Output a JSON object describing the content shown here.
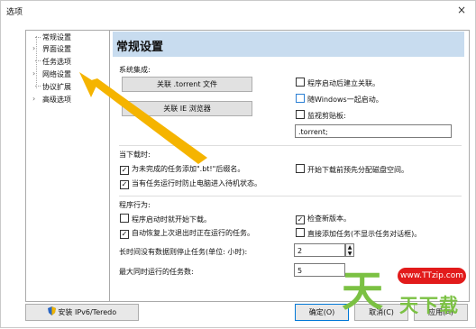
{
  "window": {
    "title": "选项",
    "close_glyph": "×"
  },
  "tree": {
    "items": [
      {
        "label": "常规设置",
        "arrow": ""
      },
      {
        "label": "界面设置",
        "arrow": "›"
      },
      {
        "label": "任务选项",
        "arrow": ""
      },
      {
        "label": "网络设置",
        "arrow": "›"
      },
      {
        "label": "协议扩展",
        "arrow": ""
      },
      {
        "label": "高级选项",
        "arrow": "›"
      }
    ]
  },
  "main": {
    "header": "常规设置",
    "system": {
      "title": "系统集成:",
      "assoc_torrent": "关联 .torrent 文件",
      "assoc_ie": "关联 IE 浏览器",
      "cb_shortcut": "程序启动后建立关联。",
      "cb_startup": "随Windows一起启动。",
      "cb_clipboard": "监视剪贴板:",
      "clipboard_value": ".torrent;"
    },
    "download": {
      "title": "当下载时:",
      "cb_bt_suffix": "为未完成的任务添加\".bt!\"后缀名。",
      "cb_prealloc": "开始下载前预先分配磁盘空间。",
      "cb_standby": "当有任务运行时防止电脑进入待机状态。"
    },
    "behavior": {
      "title": "程序行为:",
      "cb_autostart": "程序启动时就开始下载。",
      "cb_check_update": "检查新版本。",
      "cb_resume": "自动恢复上次退出时正在运行的任务。",
      "cb_direct_add": "直接添加任务(不显示任务对话框)。",
      "stop_label": "长时间没有数据则停止任务(单位: 小时):",
      "stop_value": "2",
      "max_label": "最大同时运行的任务数:",
      "max_value": "5"
    }
  },
  "bottom": {
    "install_ipv6": "安装 IPv6/Teredo",
    "ok": "确定(O)",
    "cancel": "取消(C)",
    "apply": "应用(A)"
  },
  "watermark": {
    "url": "www.TTzip.com",
    "big": "天",
    "sub": "天下载"
  },
  "colors": {
    "header_bg": "#c8dcef",
    "arrow": "#f5b400",
    "selection": "#cce4f7",
    "watermark_green": "#7bc143",
    "watermark_red": "#e21b1b"
  },
  "icons": [
    "shield-icon",
    "close-icon",
    "check-icon",
    "chevron-right-icon",
    "spin-up-icon",
    "spin-down-icon"
  ]
}
